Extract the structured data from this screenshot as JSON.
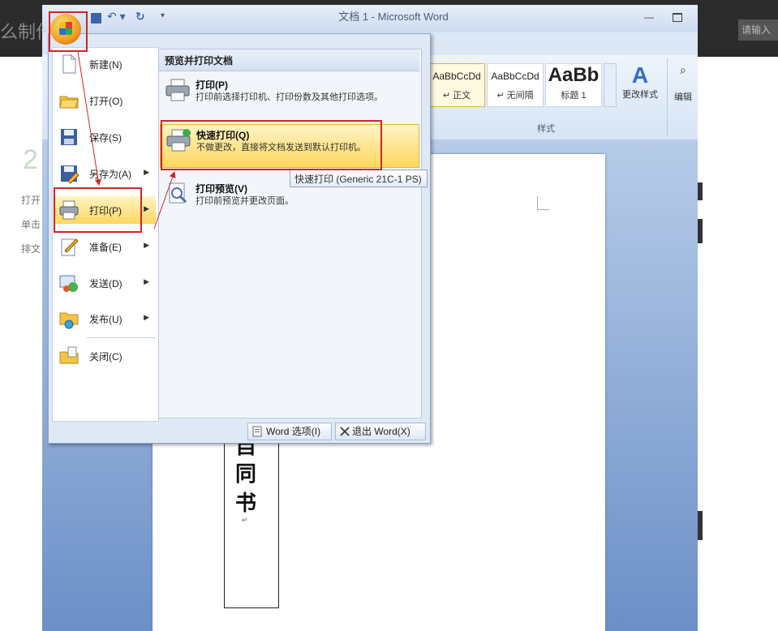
{
  "background_page": {
    "title_partial": "么制作",
    "search_partial": "请输入",
    "step_number": "2",
    "lines": [
      "打开",
      "单击",
      "排文"
    ]
  },
  "window": {
    "title": "文档 1 - Microsoft Word"
  },
  "ribbon": {
    "styles": [
      {
        "sample": "AaBbCcDd",
        "name": "↵ 正文"
      },
      {
        "sample": "AaBbCcDd",
        "name": "↵ 无间隔"
      },
      {
        "sample": "AaBb",
        "name": "标题 1"
      }
    ],
    "change_styles_label": "更改样式",
    "edit_label": "编辑",
    "styles_group_label": "样式"
  },
  "document": {
    "vertical_chars": [
      "自",
      "同",
      "书"
    ],
    "return_mark": "↵"
  },
  "office_menu": {
    "left_items": [
      {
        "label": "新建(N)"
      },
      {
        "label": "打开(O)"
      },
      {
        "label": "保存(S)"
      },
      {
        "label": "另存为(A)"
      },
      {
        "label": "打印(P)"
      },
      {
        "label": "准备(E)"
      },
      {
        "label": "发送(D)"
      },
      {
        "label": "发布(U)"
      },
      {
        "label": "关闭(C)"
      }
    ],
    "submenu_header": "预览并打印文档",
    "submenu_items": [
      {
        "title": "打印(P)",
        "desc": "打印前选择打印机、打印份数及其他打印选项。"
      },
      {
        "title": "快速打印(Q)",
        "desc": "不做更改，直接将文档发送到默认打印机。"
      },
      {
        "title": "打印预览(V)",
        "desc": "打印前预览并更改页面。"
      }
    ],
    "tooltip": "快速打印 (Generic 21C-1 PS)",
    "footer": {
      "options_label": "Word 选项(I)",
      "exit_label": "退出 Word(X)"
    }
  },
  "annotation_color": "#d42424"
}
